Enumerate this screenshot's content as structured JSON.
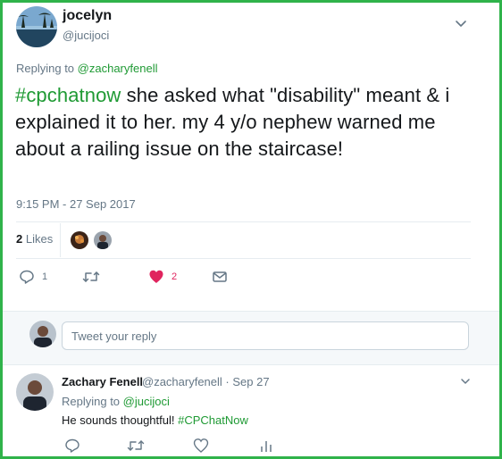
{
  "main_tweet": {
    "display_name": "jocelyn",
    "handle": "@jucijoci",
    "replying_prefix": "Replying to",
    "replying_to": "@zacharyfenell",
    "hashtag": "#cpchatnow",
    "text": " she asked what \"disability\" meant & i explained it to her. my 4 y/o nephew warned me about a railing issue on the staircase!",
    "timestamp": "9:15 PM - 27 Sep 2017",
    "likes_count": "2",
    "likes_label": "Likes",
    "actions": {
      "reply_count": "1",
      "like_count": "2"
    }
  },
  "reply_composer": {
    "placeholder": "Tweet your reply"
  },
  "reply_tweet": {
    "display_name": "Zachary Fenell",
    "handle_date": "@zacharyfenell · Sep 27",
    "replying_prefix": "Replying to",
    "replying_to": "@jucijoci",
    "text": "He sounds thoughtful! ",
    "hashtag": "#CPChatNow"
  },
  "colors": {
    "frame_border": "#2fb34a",
    "link": "#1f9a34",
    "muted": "#657786",
    "like": "#e0245e",
    "divider": "#e6ecf0"
  },
  "icons": {
    "reply": "reply-icon",
    "retweet": "retweet-icon",
    "like": "heart-icon",
    "dm": "envelope-icon",
    "analytics": "analytics-icon",
    "more": "chevron-down-icon"
  }
}
